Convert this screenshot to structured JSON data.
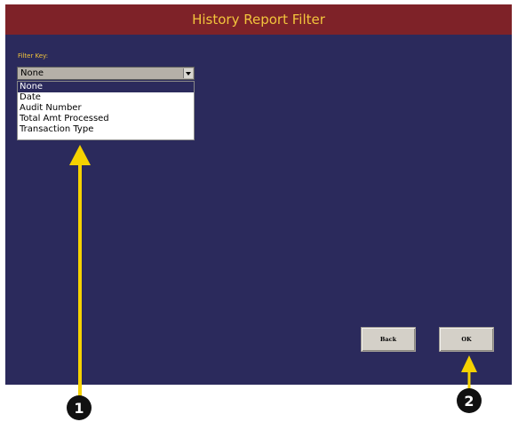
{
  "window": {
    "title": "History Report Filter"
  },
  "filter": {
    "label": "Filter Key:",
    "selected_value": "None",
    "options": [
      "None",
      "Date",
      "Audit Number",
      "Total Amt Processed",
      "Transaction Type"
    ]
  },
  "buttons": {
    "back_label": "Back",
    "ok_label": "OK"
  },
  "annotations": {
    "callout_1": "1",
    "callout_2": "2"
  },
  "colors": {
    "screen_bg": "#2b2a5c",
    "title_bar": "#7e2228",
    "title_text": "#f2c43c",
    "arrow": "#f5d200",
    "button_face": "#d4d0c8"
  },
  "icons": {
    "dropdown_arrow": "chevron-down-icon"
  }
}
